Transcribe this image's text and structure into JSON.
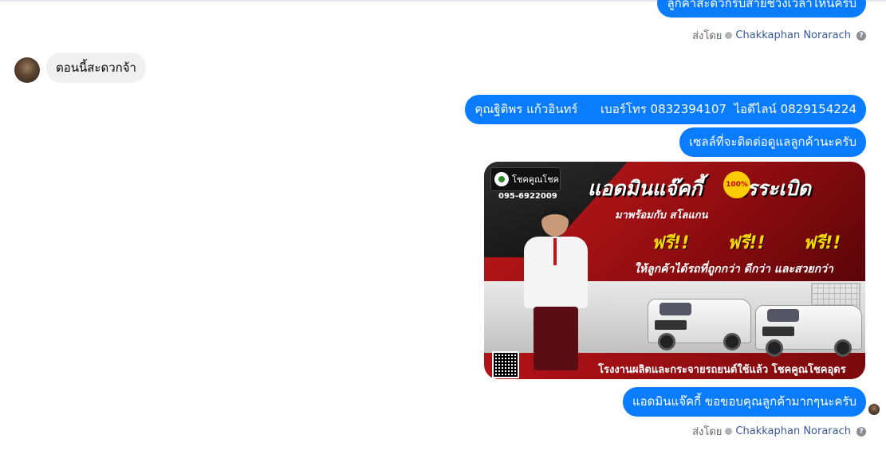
{
  "messages": {
    "top_partial": "ลูกค้าสะดวกรับสายช่วงเวลาไหนครับ",
    "sent_by_1": {
      "prefix": "ส่งโดย",
      "name": "Chakkaphan Norarach",
      "help": "?"
    },
    "incoming": "ตอนนี้สะดวกจ้า",
    "contact": "คุณฐิติพร แก้วอินทร์      เบอร์โทร 0832394107  ไอดีไลน์ 0829154224",
    "seller_intro": "เซลล์ที่จะติดต่อดูแลลูกค้านะครับ",
    "thanks": "แอดมินแจ๊คกี้ ขอขอบคุณลูกค้ามากๆนะครับ",
    "sent_by_2": {
      "prefix": "ส่งโดย",
      "name": "Chakkaphan Norarach",
      "help": "?"
    }
  },
  "promo": {
    "logo_text": "โชคคูณโชค",
    "phone": "095-6922009",
    "headline": "แอดมินแจ๊คกี้   โปรระเบิด",
    "badge": "100%",
    "sub": "มาพร้อมกับ สโลแกน",
    "free": [
      "ฟรี!!",
      "ฟรี!!",
      "ฟรี!!"
    ],
    "tagline": "ให้ลูกค้าได้รถที่ถูกกว่า ดีกว่า และสวยกว่า",
    "footer": "โรงงานผลิตและกระจายรถยนต์ใช้แล้ว โชคคูณโชคอุดร"
  },
  "colors": {
    "outgoing_bubble": "#0a7cff",
    "incoming_bubble": "#f0f0f0",
    "sender_name": "#385898"
  }
}
